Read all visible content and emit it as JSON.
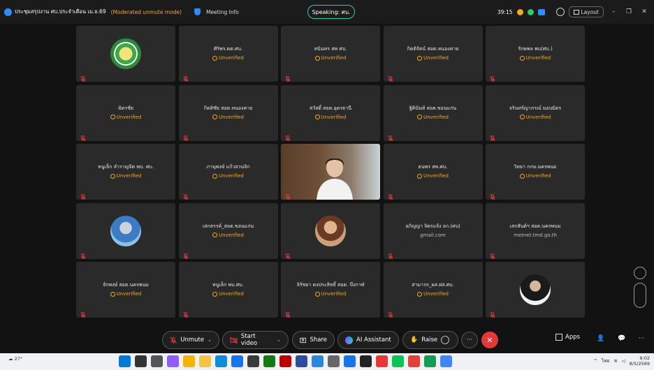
{
  "topbar": {
    "meeting_title": "ประชุมสรุปงาน ศบ.ประจำเดือน เม.ย.69",
    "mode_label": "(Moderated unmute mode)",
    "meeting_info": "Meeting Info",
    "speaking_label": "Speaking: ศบ.",
    "timer": "39:15",
    "layout_label": "Layout",
    "minimize": "–",
    "restore": "❐",
    "close": "✕"
  },
  "tiles": [
    {
      "type": "avatar",
      "avatar": "emblem",
      "name": "",
      "sub": ""
    },
    {
      "type": "name",
      "name": "ศิริพร.ตต.ศบ.",
      "sub": "Unverified"
    },
    {
      "type": "name",
      "name": "หนินทร สพ ศบ.",
      "sub": "Unverified"
    },
    {
      "type": "name",
      "name": "กิตติรัตน์ สอต.หนองคาย",
      "sub": "Unverified"
    },
    {
      "type": "name",
      "name": "รักษพล พบ(ศบ.)",
      "sub": "Unverified"
    },
    {
      "type": "name",
      "name": "ฉัตรชัย",
      "sub": "Unverified"
    },
    {
      "type": "name",
      "name": "กิตติชัย สอต.หนองคาย",
      "sub": "Unverified"
    },
    {
      "type": "name",
      "name": "สวัสดิ์ สอต.อุดรธานี",
      "sub": "Unverified"
    },
    {
      "type": "name",
      "name": "ฐิตินันท์ สอต.ขอนแก่น",
      "sub": "Unverified"
    },
    {
      "type": "name",
      "name": "จรินทร์ญาภรณ์ มอบมิตร",
      "sub": "Unverified"
    },
    {
      "type": "name",
      "name": "หนูเล็ก ลำราญจิต พบ. ศบ.",
      "sub": "Unverified"
    },
    {
      "type": "name",
      "name": "ภานุพงษ์ แก้วสวนจิก",
      "sub": "Unverified"
    },
    {
      "type": "video",
      "name": "",
      "sub": ""
    },
    {
      "type": "name",
      "name": "ธนพร สพ.ศบ.",
      "sub": "Unverified"
    },
    {
      "type": "name",
      "name": "วิทยา กกษ.นครพนม",
      "sub": "Unverified"
    },
    {
      "type": "avatar",
      "avatar": "person1",
      "name": "",
      "sub": ""
    },
    {
      "type": "name",
      "name": "เสกสรรค์_สอต.ขอนแก่น",
      "sub": "Unverified"
    },
    {
      "type": "avatar",
      "avatar": "person2",
      "name": "",
      "sub": ""
    },
    {
      "type": "name",
      "name": "อภิญญา จิตรแจ้ง อก.(ศบ)",
      "sub": "gmail.com",
      "sub_gray": true
    },
    {
      "type": "name",
      "name": "เสกสันต์ฯ สอต.นครพนม",
      "sub": "metnet.tmd.go.th",
      "sub_gray": true
    },
    {
      "type": "name",
      "name": "จักพงษ์ สอต.นครพนม",
      "sub": "Unverified"
    },
    {
      "type": "name",
      "name": "หนูเล็ก พบ.ศบ.",
      "sub": "Unverified"
    },
    {
      "type": "name",
      "name": "จิรัชยา คงประสิทธิ์ สอต. บึงกาฬ",
      "sub": "Unverified"
    },
    {
      "type": "name",
      "name": "สามารถ_ผส.ฝส.ศบ.",
      "sub": "Unverified"
    },
    {
      "type": "avatar",
      "avatar": "person3",
      "name": "",
      "sub": ""
    }
  ],
  "controls": {
    "unmute": "Unmute",
    "start_video": "Start video",
    "share": "Share",
    "ai_assistant": "AI Assistant",
    "raise": "Raise",
    "more": "···",
    "end": "✕",
    "apps": "Apps"
  },
  "taskbar": {
    "weather": "27°",
    "time": "9:02",
    "date": "8/5/2569",
    "lang": "ไทย"
  },
  "colors": {
    "accent_teal": "#37c6b8",
    "warning": "#f5a623",
    "end_red": "#e5383b",
    "tile_bg": "#2a2a2a"
  }
}
